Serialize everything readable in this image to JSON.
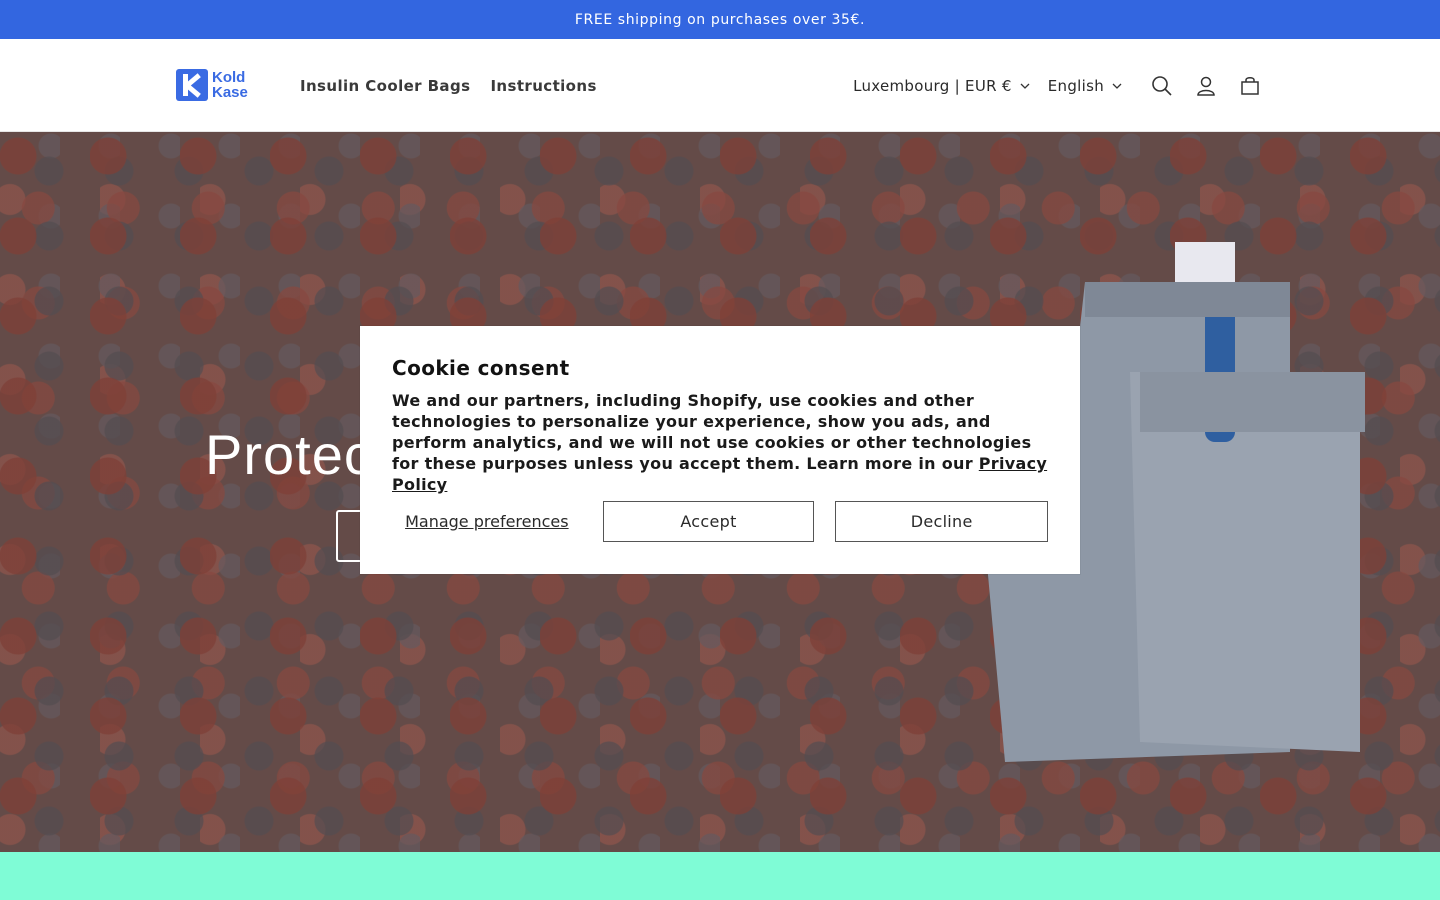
{
  "announcement": {
    "text": "FREE shipping on purchases over 35€."
  },
  "header": {
    "logo": {
      "line1": "Kold",
      "line2": "Kase"
    },
    "nav": [
      {
        "label": "Insulin Cooler Bags"
      },
      {
        "label": "Instructions"
      }
    ],
    "country_selector": "Luxembourg | EUR €",
    "language_selector": "English",
    "icons": [
      "search-icon",
      "account-icon",
      "cart-icon"
    ]
  },
  "hero": {
    "title": "Protec"
  },
  "cookie": {
    "title": "Cookie consent",
    "body": "We and our partners, including Shopify, use cookies and other technologies to personalize your experience, show you ads, and perform analytics, and we will not use cookies or other technologies for these purposes unless you accept them. Learn more in our ",
    "privacy_link": "Privacy Policy",
    "manage_label": "Manage preferences",
    "accept_label": "Accept",
    "decline_label": "Decline"
  },
  "colors": {
    "announcement_bg": "#3366e0",
    "brand": "#3a6be3",
    "bottom_band": "#7ffcd6"
  }
}
